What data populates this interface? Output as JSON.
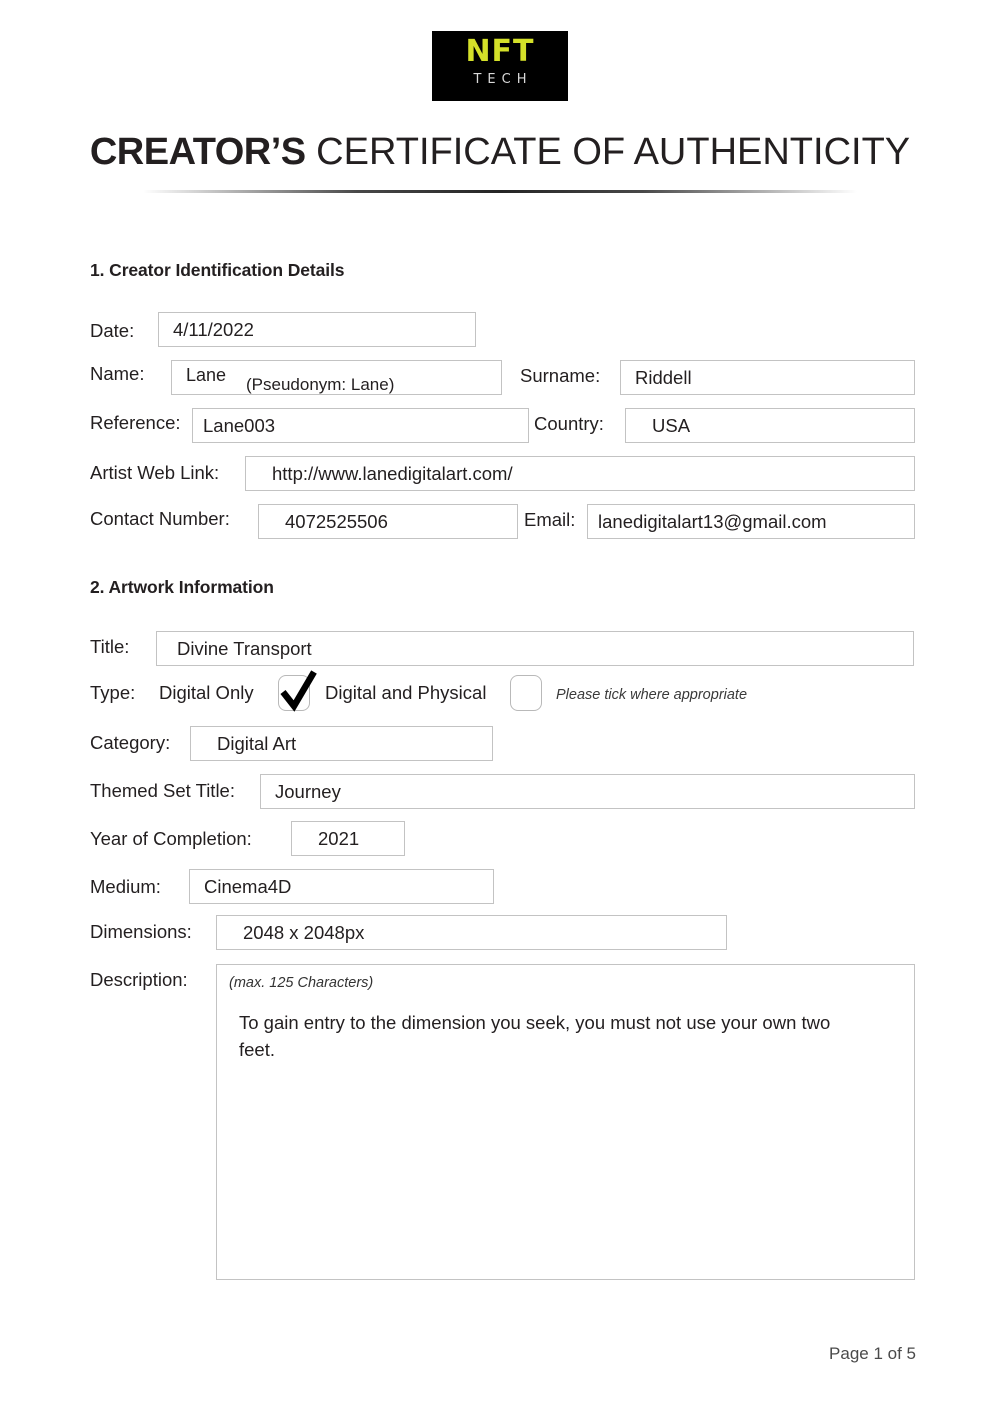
{
  "logo": {
    "primary_text": "NFT",
    "secondary_text": "TECH",
    "primary_color": "#d4e029",
    "secondary_color": "#d9d9d9",
    "background_color": "#000000"
  },
  "header": {
    "title_bold": "CREATOR’S",
    "title_light": " CERTIFICATE OF AUTHENTICITY"
  },
  "sections": {
    "creator": {
      "heading": "1. Creator Identification Details",
      "fields": {
        "date": {
          "label": "Date:",
          "value": "4/11/2022"
        },
        "name": {
          "label": "Name:",
          "value": "Lane",
          "pseudonym": "(Pseudonym: Lane)"
        },
        "surname": {
          "label": "Surname:",
          "value": "Riddell"
        },
        "reference": {
          "label": "Reference:",
          "value": "Lane003"
        },
        "country": {
          "label": "Country:",
          "value": "USA"
        },
        "web_link": {
          "label": "Artist Web Link:",
          "value": "http://www.lanedigitalart.com/"
        },
        "contact_number": {
          "label": "Contact Number:",
          "value": "4072525506"
        },
        "email": {
          "label": "Email:",
          "value": "lanedigitalart13@gmail.com"
        }
      }
    },
    "artwork": {
      "heading": "2. Artwork Information",
      "fields": {
        "title": {
          "label": "Title:",
          "value": "Divine Transport"
        },
        "type": {
          "label": "Type:",
          "option_one_label": "Digital Only",
          "option_one_checked": "true",
          "option_two_label": "Digital and Physical",
          "option_two_checked": "false",
          "hint": "Please tick where appropriate"
        },
        "category": {
          "label": "Category:",
          "value": "Digital Art"
        },
        "themed_set_title": {
          "label": "Themed Set Title:",
          "value": "Journey"
        },
        "year_of_completion": {
          "label": "Year of Completion:",
          "value": "2021"
        },
        "medium": {
          "label": "Medium:",
          "value": "Cinema4D"
        },
        "dimensions": {
          "label": "Dimensions:",
          "value": "2048 x 2048px"
        },
        "description": {
          "label": "Description:",
          "hint": "(max. 125 Characters)",
          "value": "To gain entry to the dimension you seek, you must not use your own two feet."
        }
      }
    }
  },
  "footer": {
    "page_indicator": "Page 1 of 5"
  }
}
